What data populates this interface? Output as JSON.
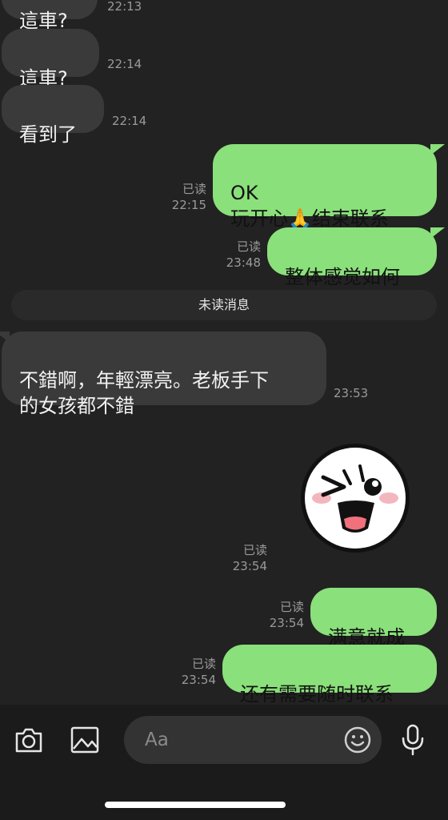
{
  "messages": {
    "m0": {
      "text": "這車?",
      "time": "22:13"
    },
    "m1": {
      "text": "這車?",
      "time": "22:14"
    },
    "m2": {
      "text": "看到了",
      "time": "22:14"
    },
    "m3": {
      "text": "OK\n玩开心🙏结束联系",
      "read": "已读",
      "time": "22:15"
    },
    "m4": {
      "text": "整体感觉如何",
      "read": "已读",
      "time": "23:48"
    },
    "m5": {
      "text": "不錯啊，年輕漂亮。老板手下\n的女孩都不錯",
      "time": "23:53"
    },
    "m6": {
      "read": "已读",
      "time": "23:54"
    },
    "m7": {
      "text": "满意就成",
      "read": "已读",
      "time": "23:54"
    },
    "m8": {
      "text": "还有需要随时联系",
      "read": "已读",
      "time": "23:54"
    }
  },
  "divider": {
    "label": "未读消息"
  },
  "input": {
    "placeholder": "Aa"
  },
  "icons": {
    "camera": "camera-icon",
    "image": "image-icon",
    "emoji": "emoji-icon",
    "mic": "microphone-icon"
  },
  "colors": {
    "background": "#222222",
    "incoming_bubble": "#3a3a3a",
    "outgoing_bubble": "#8ae07a",
    "meta_text": "#9a9a9a"
  }
}
